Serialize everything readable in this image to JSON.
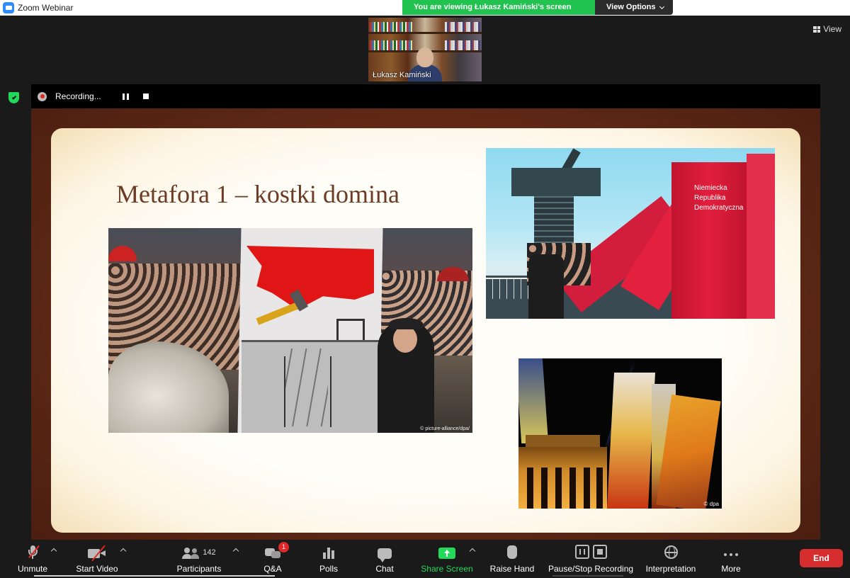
{
  "window": {
    "title": "Zoom Webinar"
  },
  "banner": {
    "viewing_text": "You are viewing Łukasz Kamiński's screen",
    "view_options": "View Options"
  },
  "view_button": {
    "label": "View"
  },
  "speaker": {
    "name": "Łukasz Kamiński"
  },
  "recording": {
    "label": "Recording..."
  },
  "slide": {
    "title": "Metafora 1 – kostki domina",
    "photo1_credit": "© picture-alliance/dpa/",
    "photo2_text_lines": [
      "Niemiecka",
      "Republika",
      "Demokratyczna"
    ],
    "photo3_credit": "© dpa"
  },
  "toolbar": {
    "unmute": "Unmute",
    "start_video": "Start Video",
    "participants": "Participants",
    "participant_count": "142",
    "qa": "Q&A",
    "qa_badge": "1",
    "polls": "Polls",
    "chat": "Chat",
    "share_screen": "Share Screen",
    "raise_hand": "Raise Hand",
    "pause_stop": "Pause/Stop Recording",
    "interpretation": "Interpretation",
    "more": "More",
    "end": "End"
  },
  "colors": {
    "accent_green": "#23d959",
    "end_red": "#d62e2e",
    "title_brown": "#6b3b24"
  }
}
